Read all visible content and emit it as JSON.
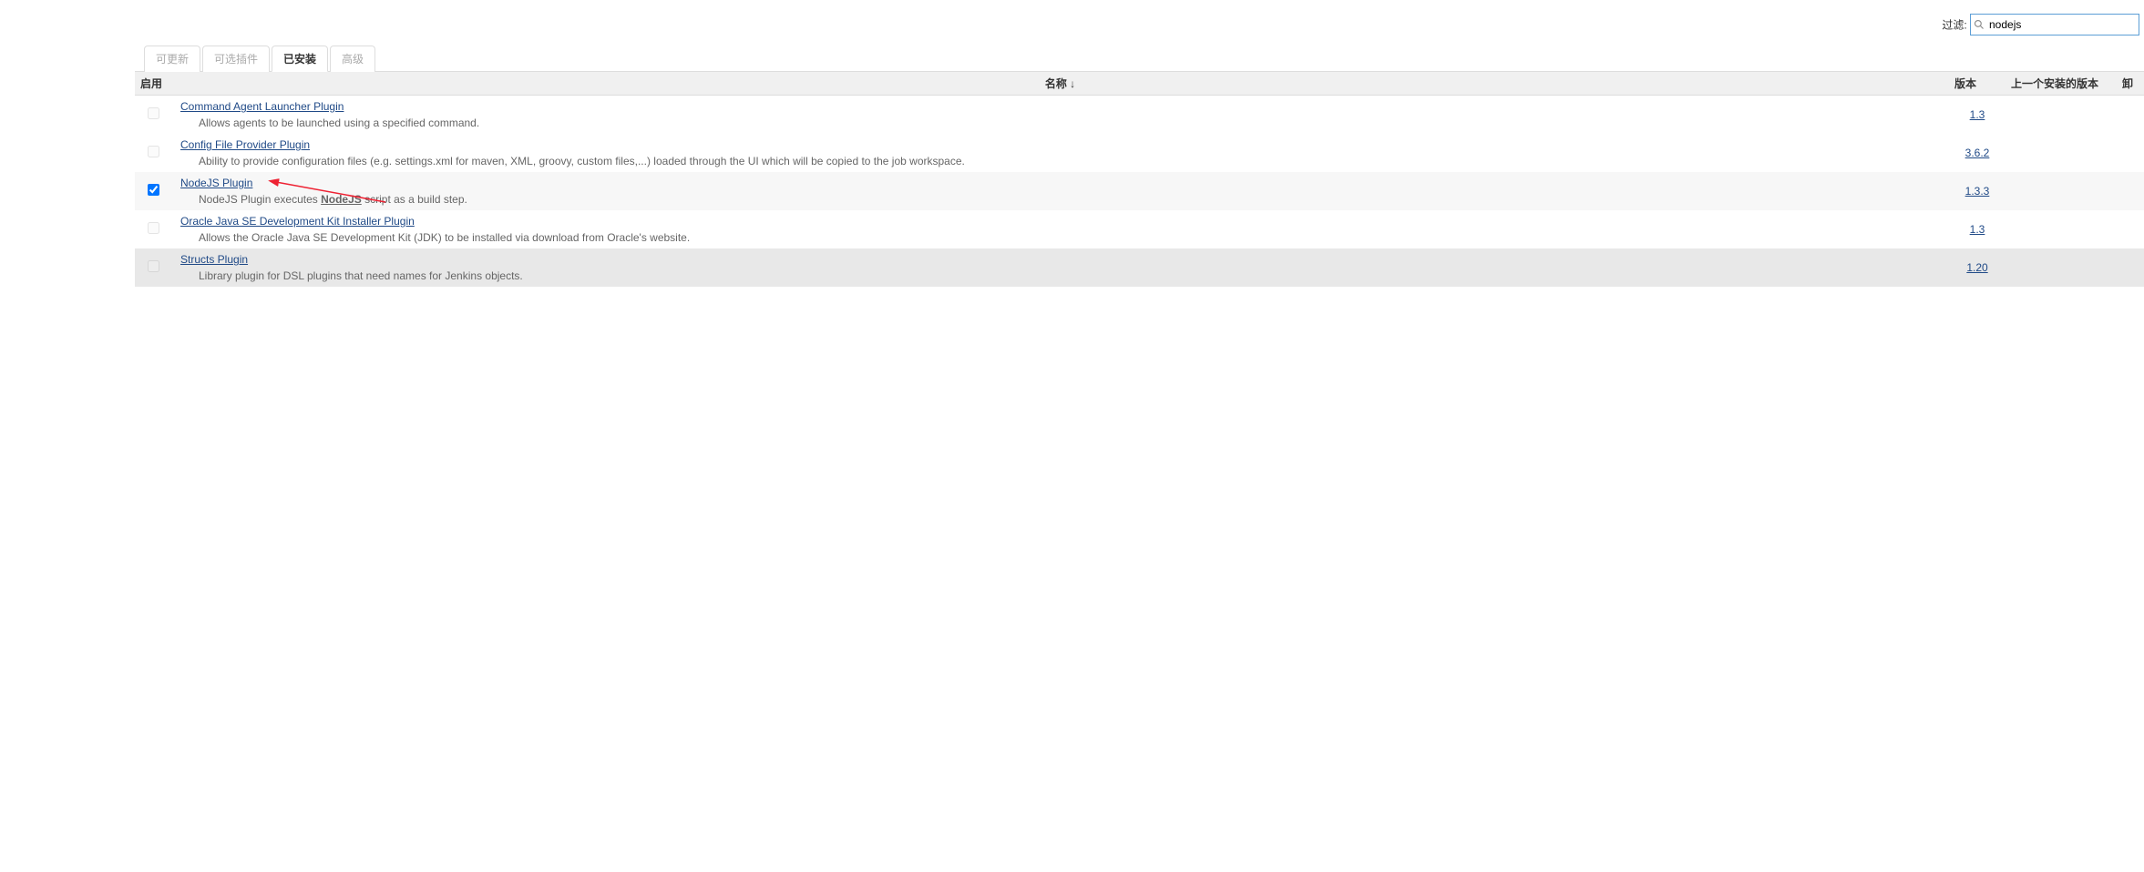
{
  "filter": {
    "label": "过滤:",
    "value": "nodejs"
  },
  "tabs": [
    {
      "label": "可更新",
      "active": false
    },
    {
      "label": "可选插件",
      "active": false
    },
    {
      "label": "已安装",
      "active": true
    },
    {
      "label": "高级",
      "active": false
    }
  ],
  "columns": {
    "enable": "启用",
    "name": "名称  ↓",
    "version": "版本",
    "prev": "上一个安装的版本",
    "uninstall": "卸"
  },
  "plugins": [
    {
      "name": "Command Agent Launcher Plugin",
      "desc": "Allows agents to be launched using a specified command.",
      "version": "1.3",
      "checked": false,
      "enabled_disabled": true,
      "highlight": false,
      "arrow": false
    },
    {
      "name": "Config File Provider Plugin",
      "desc": "Ability to provide configuration files (e.g. settings.xml for maven, XML, groovy, custom files,...) loaded through the UI which will be copied to the job workspace.",
      "version": "3.6.2",
      "checked": false,
      "enabled_disabled": true,
      "highlight": false,
      "arrow": false
    },
    {
      "name": "NodeJS Plugin",
      "desc_prefix": "NodeJS Plugin executes ",
      "desc_nodejs": "NodeJS",
      "desc_suffix": " script as a build step.",
      "version": "1.3.3",
      "checked": true,
      "enabled_disabled": false,
      "highlight": true,
      "arrow": true
    },
    {
      "name": "Oracle Java SE Development Kit Installer Plugin",
      "desc": "Allows the Oracle Java SE Development Kit (JDK) to be installed via download from Oracle's website.",
      "version": "1.3",
      "checked": false,
      "enabled_disabled": true,
      "highlight": false,
      "arrow": false
    },
    {
      "name": "Structs Plugin",
      "desc": "Library plugin for DSL plugins that need names for Jenkins objects.",
      "version": "1.20",
      "checked": false,
      "enabled_disabled": true,
      "highlight": false,
      "arrow": false,
      "row_disabled": true
    }
  ]
}
